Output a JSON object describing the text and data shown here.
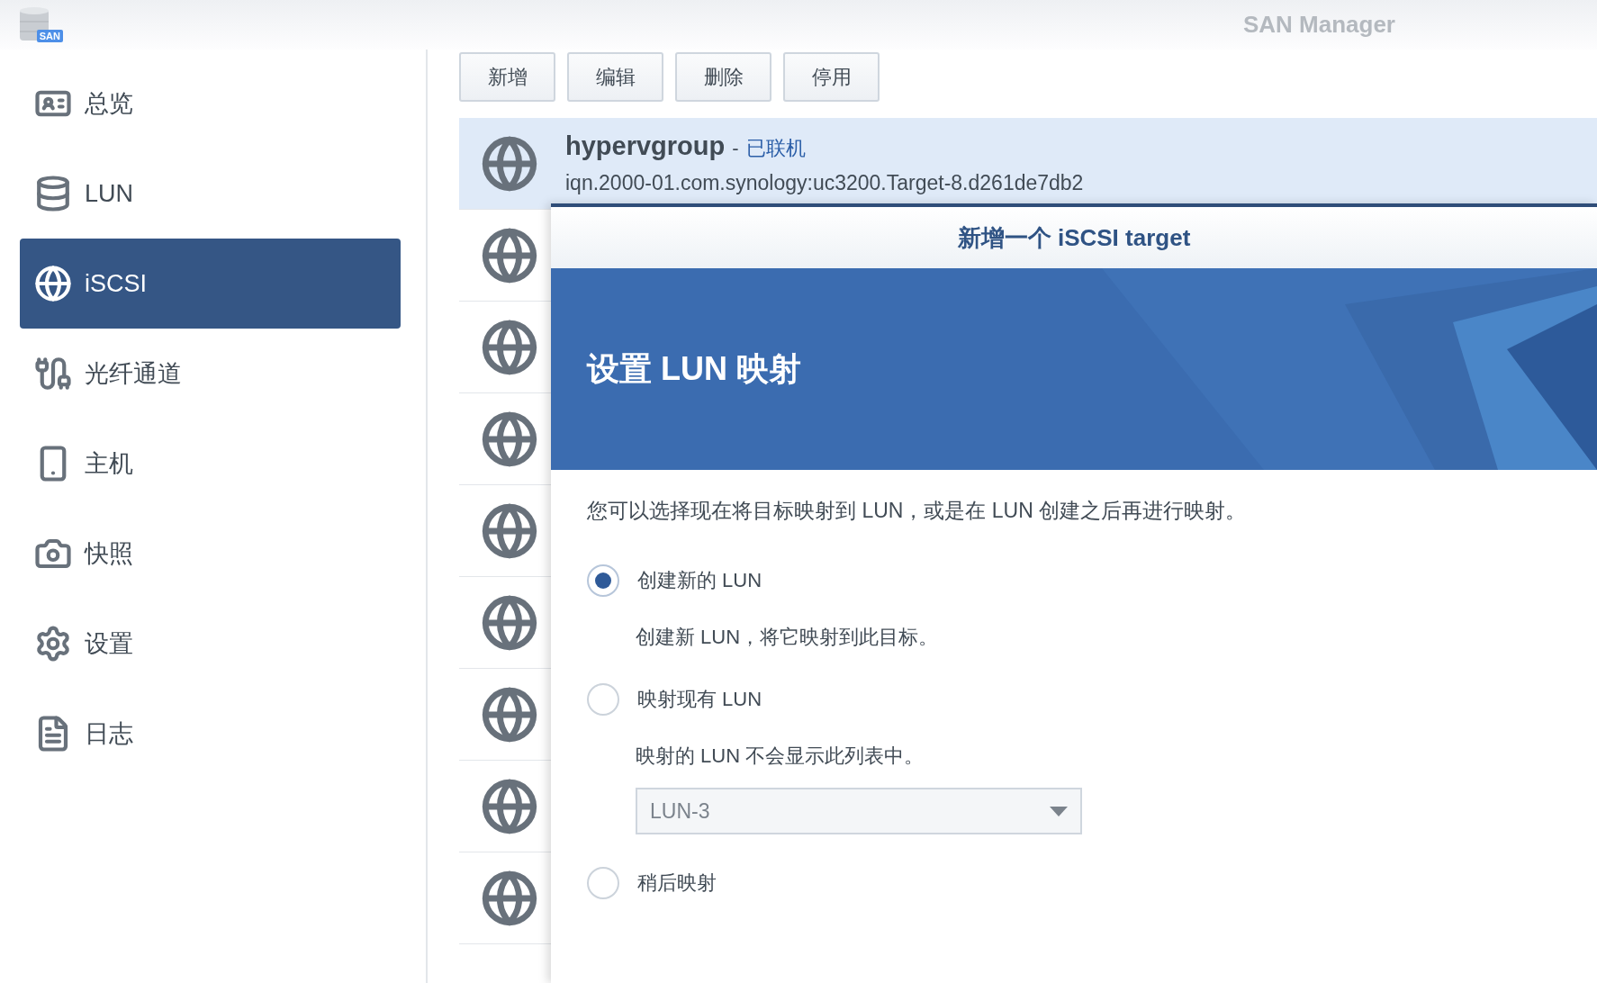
{
  "window": {
    "title": "SAN Manager",
    "logo_badge": "SAN"
  },
  "sidebar": {
    "items": [
      {
        "label": "总览",
        "selected": false
      },
      {
        "label": "LUN",
        "selected": false
      },
      {
        "label": "iSCSI",
        "selected": true
      },
      {
        "label": "光纤通道",
        "selected": false
      },
      {
        "label": "主机",
        "selected": false
      },
      {
        "label": "快照",
        "selected": false
      },
      {
        "label": "设置",
        "selected": false
      },
      {
        "label": "日志",
        "selected": false
      }
    ]
  },
  "toolbar": {
    "buttons": [
      "新增",
      "编辑",
      "删除",
      "停用"
    ]
  },
  "targets": [
    {
      "name": "hypervgroup",
      "separator": "-",
      "status": "已联机",
      "iqn": "iqn.2000-01.com.synology:uc3200.Target-8.d261de7db2",
      "selected": true
    },
    {
      "selected": false
    },
    {
      "selected": false
    },
    {
      "selected": false
    },
    {
      "selected": false
    },
    {
      "selected": false
    },
    {
      "selected": false
    },
    {
      "selected": false
    },
    {
      "selected": false
    }
  ],
  "dialog": {
    "title": "新增一个 iSCSI target",
    "heading": "设置 LUN 映射",
    "description": "您可以选择现在将目标映射到 LUN，或是在 LUN 创建之后再进行映射。",
    "options": [
      {
        "label": "创建新的 LUN",
        "description": "创建新 LUN，将它映射到此目标。",
        "selected": true
      },
      {
        "label": "映射现有 LUN",
        "description": "映射的 LUN 不会显示此列表中。",
        "selected": false,
        "select": {
          "value": "LUN-3",
          "disabled": true
        }
      },
      {
        "label": "稍后映射",
        "selected": false
      }
    ]
  }
}
